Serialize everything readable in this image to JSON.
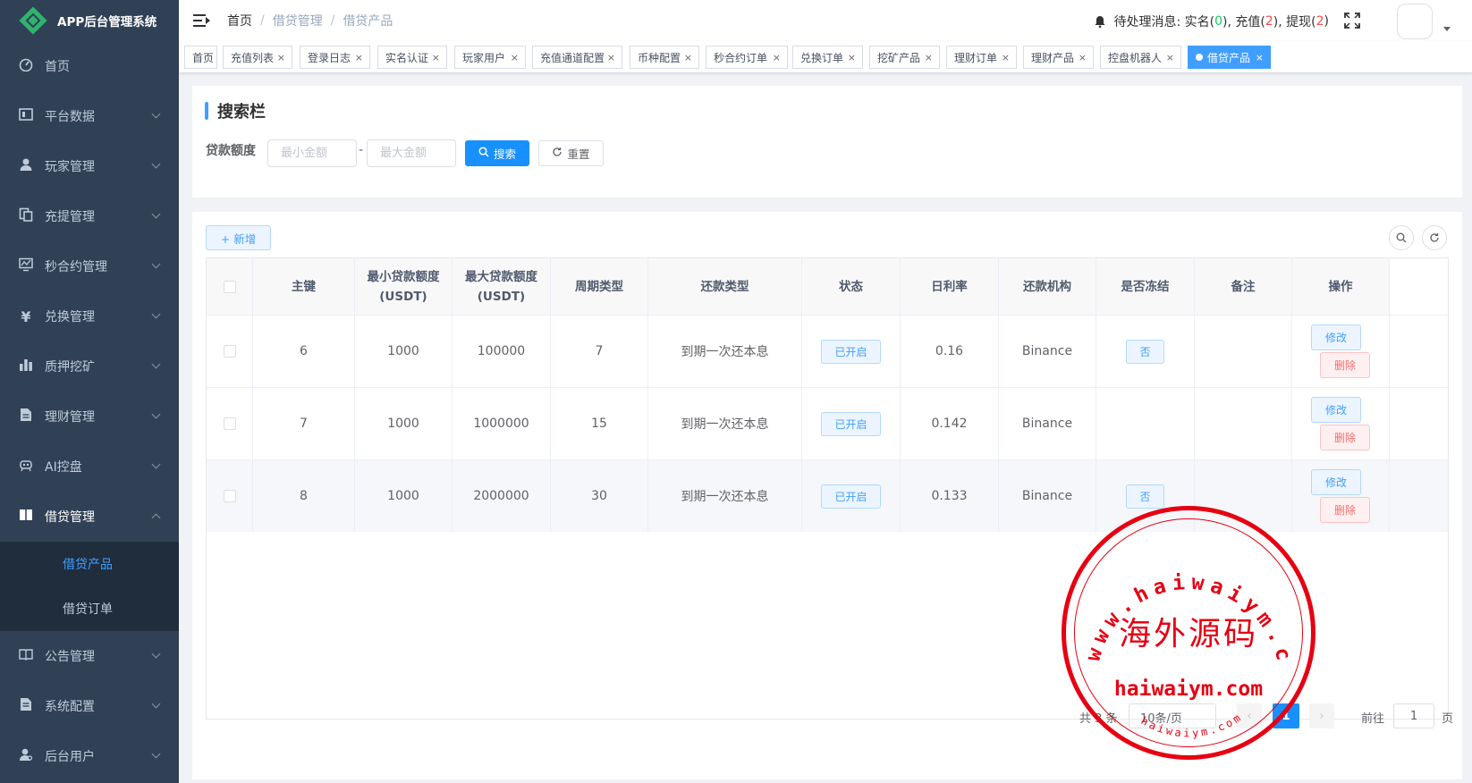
{
  "app": {
    "title": "APP后台管理系统"
  },
  "sidebar": {
    "items": [
      {
        "label": "首页",
        "icon": "dashboard-icon"
      },
      {
        "label": "平台数据",
        "icon": "chart-icon"
      },
      {
        "label": "玩家管理",
        "icon": "user-icon"
      },
      {
        "label": "充提管理",
        "icon": "documents-icon"
      },
      {
        "label": "秒合约管理",
        "icon": "monitor-icon"
      },
      {
        "label": "兑换管理",
        "icon": "yen-icon"
      },
      {
        "label": "质押挖矿",
        "icon": "bar-chart-icon"
      },
      {
        "label": "理财管理",
        "icon": "file-icon"
      },
      {
        "label": "AI控盘",
        "icon": "robot-icon"
      },
      {
        "label": "借贷管理",
        "icon": "book-icon"
      }
    ],
    "sub_items": [
      {
        "label": "借贷产品",
        "active": true
      },
      {
        "label": "借贷订单",
        "active": false
      }
    ],
    "items_after": [
      {
        "label": "公告管理",
        "icon": "book-open-icon"
      },
      {
        "label": "系统配置",
        "icon": "settings-file-icon"
      },
      {
        "label": "后台用户",
        "icon": "admin-user-icon"
      }
    ]
  },
  "header": {
    "breadcrumb": [
      "首页",
      "借贷管理",
      "借贷产品"
    ],
    "notice_prefix": "待处理消息: 实名(",
    "notice_real": "0",
    "notice_mid1": "), 充值(",
    "notice_recharge": "2",
    "notice_mid2": "), 提现(",
    "notice_withdraw": "2",
    "notice_suffix": ")"
  },
  "tags": [
    "首页",
    "充值列表",
    "登录日志",
    "实名认证",
    "玩家用户",
    "充值通道配置",
    "币种配置",
    "秒合约订单",
    "兑换订单",
    "挖矿产品",
    "理财订单",
    "理财产品",
    "控盘机器人",
    "借贷产品"
  ],
  "search": {
    "title": "搜索栏",
    "field_label": "贷款额度",
    "min_placeholder": "最小金额",
    "max_placeholder": "最大金额",
    "dash": "-",
    "search_label": "搜索",
    "reset_label": "重置"
  },
  "table": {
    "add_label": "+ 新增",
    "headers": [
      "主键",
      "最小贷款额度(USDT)",
      "最大贷款额度(USDT)",
      "周期类型",
      "还款类型",
      "状态",
      "日利率",
      "还款机构",
      "是否冻结",
      "备注",
      "操作"
    ],
    "rows": [
      {
        "id": "6",
        "min": "1000",
        "max": "100000",
        "cycle": "7",
        "repay_type": "到期一次还本息",
        "status": "已开启",
        "rate": "0.16",
        "org": "Binance",
        "frozen": "否",
        "remark": ""
      },
      {
        "id": "7",
        "min": "1000",
        "max": "1000000",
        "cycle": "15",
        "repay_type": "到期一次还本息",
        "status": "已开启",
        "rate": "0.142",
        "org": "Binance",
        "frozen": "",
        "remark": ""
      },
      {
        "id": "8",
        "min": "1000",
        "max": "2000000",
        "cycle": "30",
        "repay_type": "到期一次还本息",
        "status": "已开启",
        "rate": "0.133",
        "org": "Binance",
        "frozen": "否",
        "remark": ""
      }
    ],
    "edit_label": "修改",
    "delete_label": "删除"
  },
  "pagination": {
    "total": "共 3 条",
    "page_size": "10条/页",
    "current": "1",
    "goto_prefix": "前往",
    "goto_value": "1",
    "goto_suffix": "页"
  },
  "watermark": {
    "center": "海外源码",
    "domain": "haiwaiym.com",
    "ring_top": "www.haiwaiym.com",
    "ring_bottom": "haiwaiym.com"
  },
  "colors": {
    "sidebar_bg": "#304156",
    "primary": "#1890ff",
    "watermark": "#e60012"
  }
}
